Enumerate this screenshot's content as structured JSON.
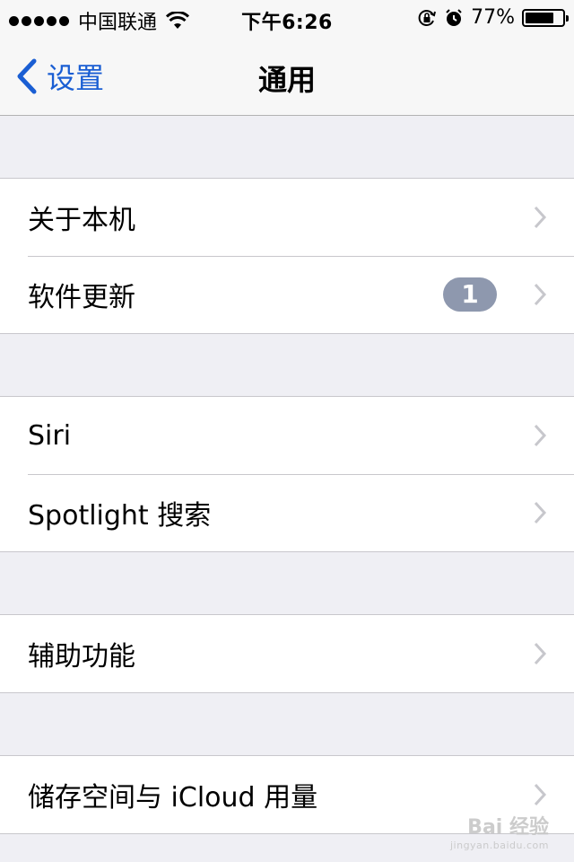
{
  "status_bar": {
    "carrier": "中国联通",
    "time": "下午6:26",
    "battery_percent": "77%",
    "battery_level": 0.77,
    "signal_bars": 5
  },
  "nav": {
    "back_label": "设置",
    "title": "通用"
  },
  "groups": [
    {
      "items": [
        {
          "label": "关于本机"
        },
        {
          "label": "软件更新",
          "badge": "1"
        }
      ]
    },
    {
      "items": [
        {
          "label": "Siri"
        },
        {
          "label": "Spotlight 搜索"
        }
      ]
    },
    {
      "items": [
        {
          "label": "辅助功能"
        }
      ]
    },
    {
      "items": [
        {
          "label": "储存空间与 iCloud 用量"
        }
      ]
    }
  ],
  "watermark": {
    "brand": "Bai 经验",
    "url": "jingyan.baidu.com"
  },
  "colors": {
    "accent": "#1a5ed3",
    "badge": "#8e98ae",
    "background": "#efeff4",
    "separator": "#c8c7cc"
  },
  "icons": [
    "wifi-icon",
    "orientation-lock-icon",
    "alarm-icon",
    "battery-icon",
    "back-chevron-icon",
    "chevron-right-icon"
  ]
}
